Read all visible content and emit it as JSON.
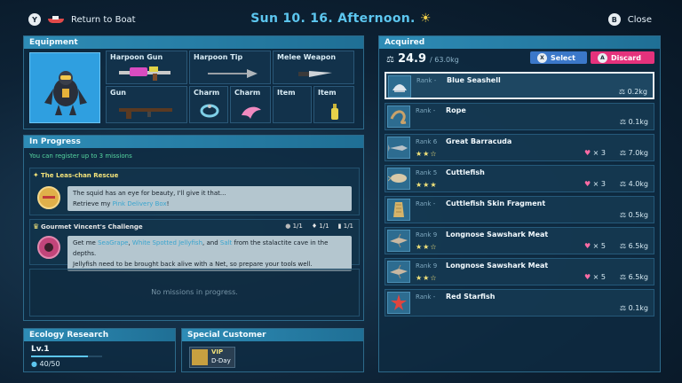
{
  "header": {
    "back_button_glyph": "Y",
    "back_label": "Return to Boat",
    "title": "Sun 10. 16.  Afternoon.",
    "title_icon": "sun-icon",
    "close_glyph": "B",
    "close_label": "Close"
  },
  "equipment": {
    "heading": "Equipment",
    "slots": [
      {
        "label": "Harpoon Gun"
      },
      {
        "label": "Harpoon Tip"
      },
      {
        "label": "Melee Weapon"
      },
      {
        "label": "Gun"
      },
      {
        "label": "Charm"
      },
      {
        "label": "Charm"
      },
      {
        "label": "Item"
      },
      {
        "label": "Item"
      }
    ]
  },
  "in_progress": {
    "heading": "In Progress",
    "register_note": "You can register up to 3 missions",
    "missions": [
      {
        "title": "The Leas-chan Rescue",
        "text_line1": "The squid has an eye for beauty, I'll give it that...",
        "text_line2_pre": "Retrieve my ",
        "text_line2_hl": "Pink Delivery Box",
        "text_line2_post": "!"
      },
      {
        "title": "Gourmet Vincent's Challenge",
        "counters": [
          "1/1",
          "1/1",
          "1/1"
        ],
        "text_a": "Get me ",
        "text_hl1": "SeaGrape",
        "text_b": ", ",
        "text_hl2": "White Spotted Jellyfish",
        "text_c": ", and ",
        "text_hl3": "Salt",
        "text_d": " from the stalactite cave in the depths.",
        "text_line2": "Jellyfish need to be brought back alive with a Net, so prepare your tools well."
      }
    ],
    "empty_note": "No missions in progress."
  },
  "ecology": {
    "heading": "Ecology Research",
    "level": "Lv.1",
    "progress": "40/50",
    "progress_fraction": 0.8
  },
  "special": {
    "heading": "Special Customer",
    "badge_top": "VIP",
    "badge_bottom": "D-Day"
  },
  "acquired": {
    "heading": "Acquired",
    "weight_icon": "weight-icon",
    "weight": "24.9",
    "max_weight": "/ 63.0kg",
    "select_glyph": "X",
    "select_label": "Select",
    "discard_glyph": "A",
    "discard_label": "Discard",
    "items": [
      {
        "rank": "Rank -",
        "name": "Blue Seashell",
        "stars": "",
        "qty": "",
        "weight": "0.2kg",
        "selected": true
      },
      {
        "rank": "Rank -",
        "name": "Rope",
        "stars": "",
        "qty": "",
        "weight": "0.1kg"
      },
      {
        "rank": "Rank 6",
        "name": "Great Barracuda",
        "stars": "★★☆",
        "qty": "× 3",
        "weight": "7.0kg"
      },
      {
        "rank": "Rank 5",
        "name": "Cuttlefish",
        "stars": "★★★",
        "qty": "× 3",
        "weight": "4.0kg"
      },
      {
        "rank": "Rank -",
        "name": "Cuttlefish Skin Fragment",
        "stars": "",
        "qty": "",
        "weight": "0.5kg"
      },
      {
        "rank": "Rank 9",
        "name": "Longnose Sawshark Meat",
        "stars": "★★☆",
        "qty": "× 5",
        "weight": "6.5kg"
      },
      {
        "rank": "Rank 9",
        "name": "Longnose Sawshark Meat",
        "stars": "★★☆",
        "qty": "× 5",
        "weight": "6.5kg"
      },
      {
        "rank": "Rank -",
        "name": "Red Starfish",
        "stars": "",
        "qty": "",
        "weight": "0.1kg"
      }
    ]
  },
  "colors": {
    "accent": "#2e8cb6",
    "title": "#5cc6ef",
    "select_button": "#3b78c9",
    "discard_button": "#e5327c",
    "mission_title": "#f3e37a",
    "register_note": "#56d6a0"
  }
}
